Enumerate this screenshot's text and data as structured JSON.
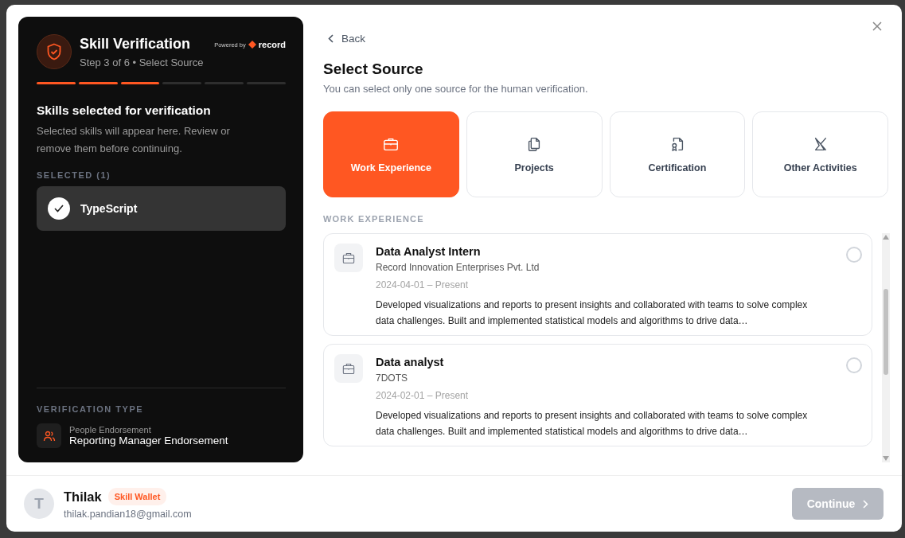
{
  "header": {
    "title": "Skill Verification",
    "subtitle": "Step 3 of 6 • Select Source",
    "powered_by": "Powered by",
    "brand": "record"
  },
  "steps": [
    {
      "done": true
    },
    {
      "done": true
    },
    {
      "done": true
    },
    {
      "done": false
    },
    {
      "done": false
    },
    {
      "done": false
    }
  ],
  "skills_panel": {
    "title": "Skills selected for verification",
    "description": "Selected skills will appear here. Review or remove them before continuing.",
    "selected_label": "SELECTED (1)",
    "skills": [
      {
        "name": "TypeScript",
        "checked": true
      }
    ]
  },
  "verification_type": {
    "label": "VERIFICATION TYPE",
    "category": "People Endorsement",
    "value": "Reporting Manager Endorsement"
  },
  "back": "Back",
  "source": {
    "title": "Select Source",
    "subtitle": "You can select only one source for the human verification.",
    "options": [
      {
        "kind": "briefcase",
        "label": "Work Experience",
        "selected": true
      },
      {
        "kind": "files",
        "label": "Projects",
        "selected": false
      },
      {
        "kind": "certificate",
        "label": "Certification",
        "selected": false
      },
      {
        "kind": "activity",
        "label": "Other Activities",
        "selected": false
      }
    ]
  },
  "section_label": "WORK EXPERIENCE",
  "experiences": [
    {
      "title": "Data Analyst Intern",
      "company": "Record Innovation Enterprises Pvt. Ltd",
      "dates": "2024-04-01 – Present",
      "description": "Developed visualizations and reports to present insights and collaborated with teams to solve complex data challenges. Built and implemented statistical models and algorithms to drive data…",
      "selected": false
    },
    {
      "title": "Data analyst",
      "company": "7DOTS",
      "dates": "2024-02-01 – Present",
      "description": "Developed visualizations and reports to present insights and collaborated with teams to solve complex data challenges. Built and implemented statistical models and algorithms to drive data…",
      "selected": false
    }
  ],
  "user": {
    "initial": "T",
    "name": "Thilak",
    "badge": "Skill Wallet",
    "email": "thilak.pandian18@gmail.com"
  },
  "continue": {
    "label": "Continue",
    "disabled": true
  }
}
